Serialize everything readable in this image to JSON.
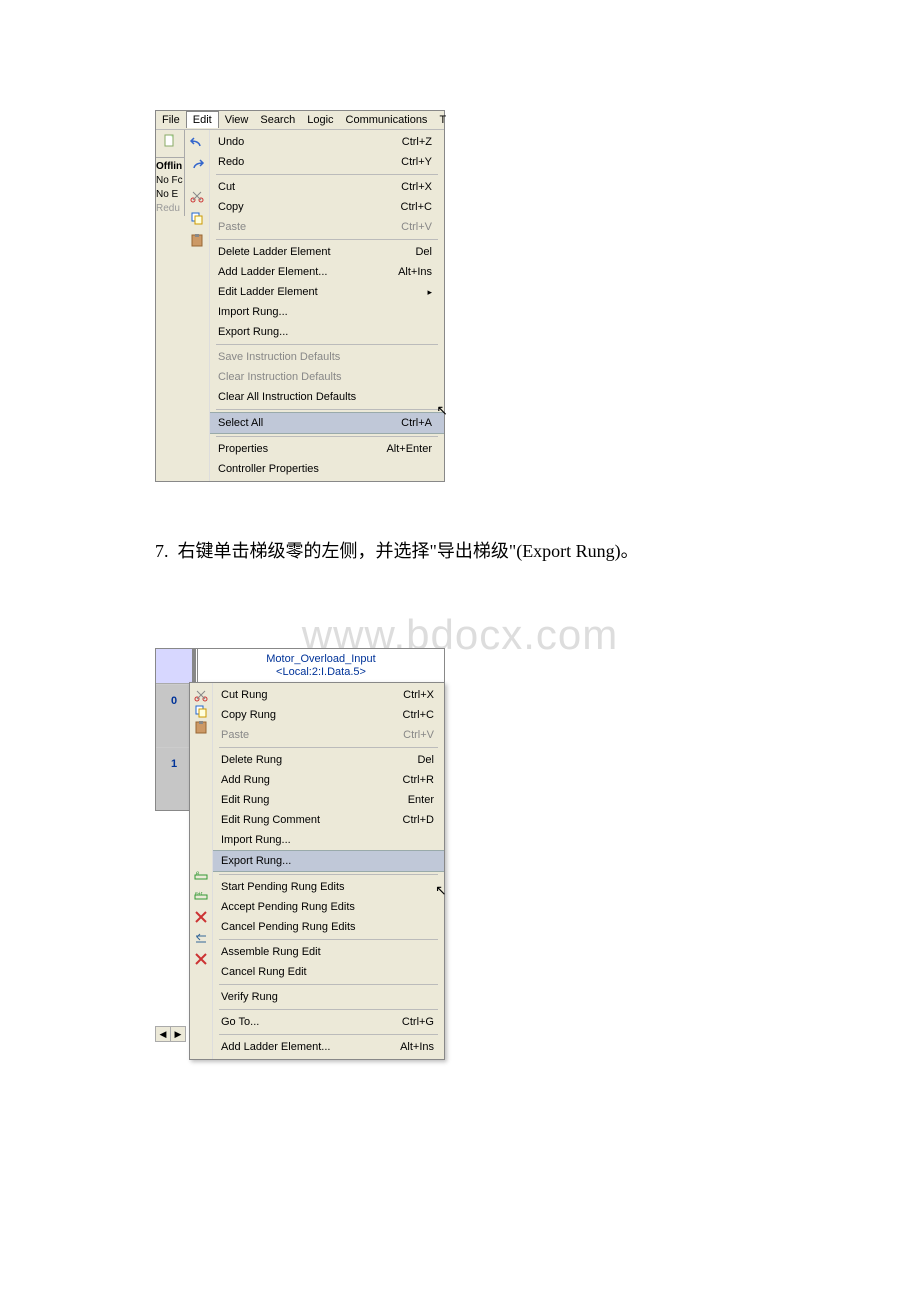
{
  "menubar": {
    "file": "File",
    "edit": "Edit",
    "view": "View",
    "search": "Search",
    "logic": "Logic",
    "comms": "Communications",
    "t": "T"
  },
  "sidepanel": {
    "offline": "Offlin",
    "nofc": "No Fc",
    "noe": "No E",
    "redu": "Redu"
  },
  "editmenu": [
    {
      "icon": "undo",
      "label": "Undo",
      "shortcut": "Ctrl+Z",
      "enabled": true
    },
    {
      "icon": "redo",
      "label": "Redo",
      "shortcut": "Ctrl+Y",
      "enabled": true
    },
    "sep",
    {
      "icon": "cut",
      "label": "Cut",
      "shortcut": "Ctrl+X",
      "enabled": true
    },
    {
      "icon": "copy",
      "label": "Copy",
      "shortcut": "Ctrl+C",
      "enabled": true
    },
    {
      "icon": "paste",
      "label": "Paste",
      "shortcut": "Ctrl+V",
      "enabled": false
    },
    "sep",
    {
      "label": "Delete Ladder Element",
      "shortcut": "Del",
      "enabled": true
    },
    {
      "label": "Add Ladder Element...",
      "shortcut": "Alt+Ins",
      "enabled": true
    },
    {
      "label": "Edit Ladder Element",
      "submenu": true,
      "enabled": true
    },
    {
      "label": "Import Rung...",
      "enabled": true
    },
    {
      "label": "Export Rung...",
      "enabled": true
    },
    "sep",
    {
      "label": "Save Instruction Defaults",
      "enabled": false
    },
    {
      "label": "Clear Instruction Defaults",
      "enabled": false
    },
    {
      "label": "Clear All Instruction Defaults",
      "enabled": true
    },
    "sep",
    {
      "label": "Select All",
      "shortcut": "Ctrl+A",
      "highlight": true,
      "enabled": true
    },
    "sep",
    {
      "label": "Properties",
      "shortcut": "Alt+Enter",
      "enabled": true
    },
    {
      "label": "Controller Properties",
      "enabled": true
    }
  ],
  "instruction": {
    "num": "7.",
    "text": "右键单击梯级零的左侧，并选择\"导出梯级\"(Export Rung)。"
  },
  "watermark": "www.bdocx.com",
  "rung": {
    "zero": "0",
    "one": "1",
    "tag1": "Motor_Overload_Input",
    "tag2": "<Local:2:I.Data.5>"
  },
  "ctx2": [
    {
      "icon": "cut",
      "label": "Cut Rung",
      "shortcut": "Ctrl+X",
      "enabled": true
    },
    {
      "icon": "copy",
      "label": "Copy Rung",
      "shortcut": "Ctrl+C",
      "enabled": true
    },
    {
      "icon": "paste",
      "label": "Paste",
      "shortcut": "Ctrl+V",
      "enabled": false
    },
    "sep",
    {
      "label": "Delete Rung",
      "shortcut": "Del",
      "enabled": true
    },
    {
      "label": "Add Rung",
      "shortcut": "Ctrl+R",
      "enabled": true
    },
    {
      "label": "Edit Rung",
      "shortcut": "Enter",
      "enabled": true
    },
    {
      "label": "Edit Rung Comment",
      "shortcut": "Ctrl+D",
      "enabled": true
    },
    {
      "label": "Import Rung...",
      "enabled": true
    },
    {
      "label": "Export Rung...",
      "highlight": true,
      "enabled": true
    },
    "sep",
    {
      "icon": "start",
      "label": "Start Pending Rung Edits",
      "enabled": true
    },
    {
      "icon": "accept",
      "label": "Accept Pending Rung Edits",
      "enabled": true
    },
    {
      "icon": "cancel",
      "label": "Cancel Pending Rung Edits",
      "enabled": true
    },
    "sep",
    {
      "icon": "assemble",
      "label": "Assemble Rung Edit",
      "enabled": true
    },
    {
      "icon": "cancel2",
      "label": "Cancel Rung Edit",
      "enabled": true
    },
    "sep",
    {
      "label": "Verify Rung",
      "enabled": true
    },
    "sep",
    {
      "label": "Go To...",
      "shortcut": "Ctrl+G",
      "enabled": true
    },
    "sep",
    {
      "label": "Add Ladder Element...",
      "shortcut": "Alt+Ins",
      "enabled": true
    }
  ]
}
